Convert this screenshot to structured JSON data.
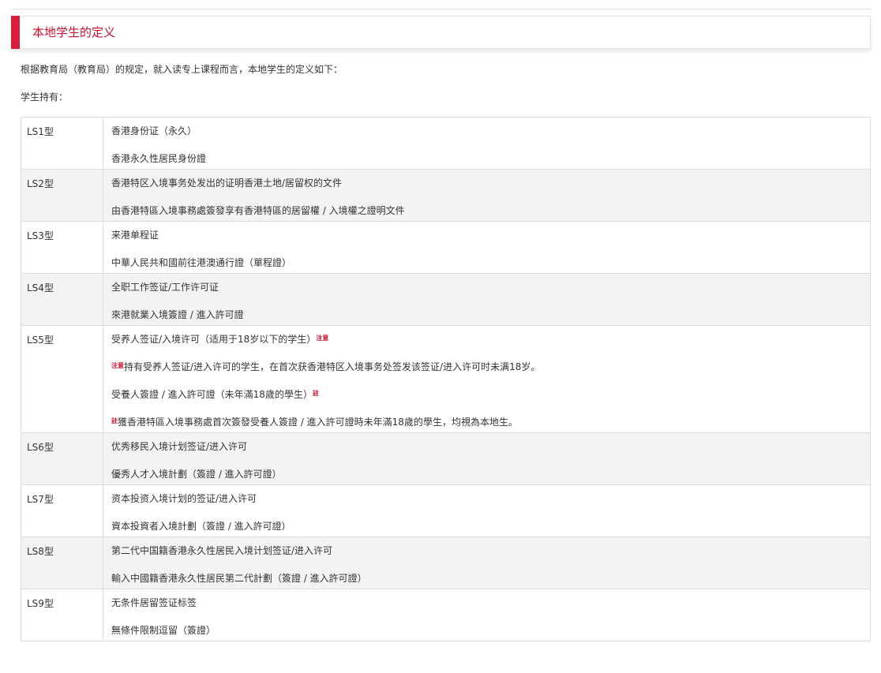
{
  "section": {
    "title": "本地学生的定义"
  },
  "intro": "根据教育局（教育局）的规定，就入读专上课程而言，本地学生的定义如下：",
  "holds_label": "学生持有：",
  "rows": [
    {
      "type": "LS1型",
      "lines": [
        {
          "text": "香港身份证（永久）"
        },
        {
          "text": "香港永久性居民身份證"
        }
      ]
    },
    {
      "type": "LS2型",
      "lines": [
        {
          "text": "香港特区入境事务处发出的证明香港土地/居留权的文件"
        },
        {
          "text": "由香港特區入境事務處簽發享有香港特區的居留權 / 入境權之證明文件"
        }
      ]
    },
    {
      "type": "LS3型",
      "lines": [
        {
          "text": "来港单程证"
        },
        {
          "text": "中華人民共和國前往港澳通行證（單程證）"
        }
      ]
    },
    {
      "type": "LS4型",
      "lines": [
        {
          "text": "全职工作签证/工作许可证"
        },
        {
          "text": "來港就業入境簽證 / 進入許可證"
        }
      ]
    },
    {
      "type": "LS5型",
      "lines": [
        {
          "text": "受养人签证/入境许可（适用于18岁以下的学生）",
          "note_after": "注意"
        },
        {
          "text": "持有受养人签证/进入许可的学生，在首次获香港特区入境事务处签发该签证/进入许可时未满18岁。",
          "note_before": "注意"
        },
        {
          "text": "受養人簽證 / 進入許可證（未年滿18歲的學生）",
          "note_after": "註"
        },
        {
          "text": "獲香港特區入境事務處首次簽發受養人簽證 / 進入許可證時未年滿18歲的學生，均視為本地生。",
          "note_before": "註"
        }
      ]
    },
    {
      "type": "LS6型",
      "lines": [
        {
          "text": "优秀移民入境计划签证/进入许可"
        },
        {
          "text": "優秀人才入境計劃（簽證 / 進入許可證）"
        }
      ]
    },
    {
      "type": "LS7型",
      "lines": [
        {
          "text": "资本投资入境计划的签证/进入许可"
        },
        {
          "text": "資本投資者入境計劃（簽證 / 進入許可證）"
        }
      ]
    },
    {
      "type": "LS8型",
      "lines": [
        {
          "text": "第二代中国籍香港永久性居民入境计划签证/进入许可"
        },
        {
          "text": "輸入中國籍香港永久性居民第二代計劃（簽證 / 進入許可證）"
        }
      ]
    },
    {
      "type": "LS9型",
      "lines": [
        {
          "text": "无条件居留签证标签"
        },
        {
          "text": "無條件限制逗留（簽證）"
        }
      ]
    }
  ],
  "colors": {
    "accent": "#d71e3c",
    "title": "#c8102e",
    "shade": "#f3f3f3"
  }
}
